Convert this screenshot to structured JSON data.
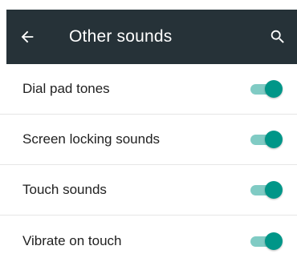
{
  "header": {
    "title": "Other sounds",
    "back_icon": "arrow-left-icon",
    "search_icon": "search-icon",
    "background": "#263238"
  },
  "settings": [
    {
      "label": "Dial pad tones",
      "enabled": true
    },
    {
      "label": "Screen locking sounds",
      "enabled": true
    },
    {
      "label": "Touch sounds",
      "enabled": true
    },
    {
      "label": "Vibrate on touch",
      "enabled": true
    }
  ],
  "colors": {
    "accent": "#009688",
    "track_on": "#80CBC4",
    "thumb_off": "#ECECEC",
    "track_off": "#B2B2B2"
  }
}
